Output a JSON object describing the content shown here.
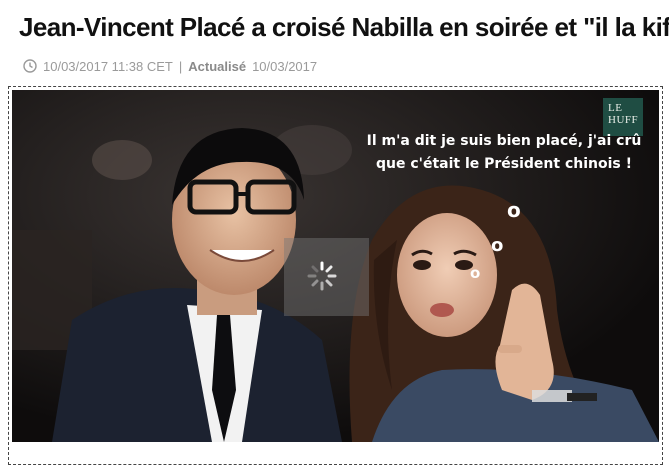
{
  "article": {
    "headline": "Jean-Vincent Placé a croisé Nabilla en soirée et \"il la kif\"",
    "published": "10/03/2017 11:38 CET",
    "separator": "|",
    "updated_label": "Actualisé",
    "updated_date": "10/03/2017"
  },
  "photo": {
    "logo_line1": "LE",
    "logo_line2": "HUFF",
    "caption": "Il m'a dit je suis bien placé, j'ai crû que c'était le Président chinois !",
    "bubbles": [
      "o",
      "o",
      "o"
    ]
  },
  "icons": {
    "clock": "clock-icon",
    "spinner": "loading-spinner-icon"
  },
  "colors": {
    "headline": "#111111",
    "meta_text": "#9a9a9a",
    "logo_bg": "#1f4d43"
  }
}
